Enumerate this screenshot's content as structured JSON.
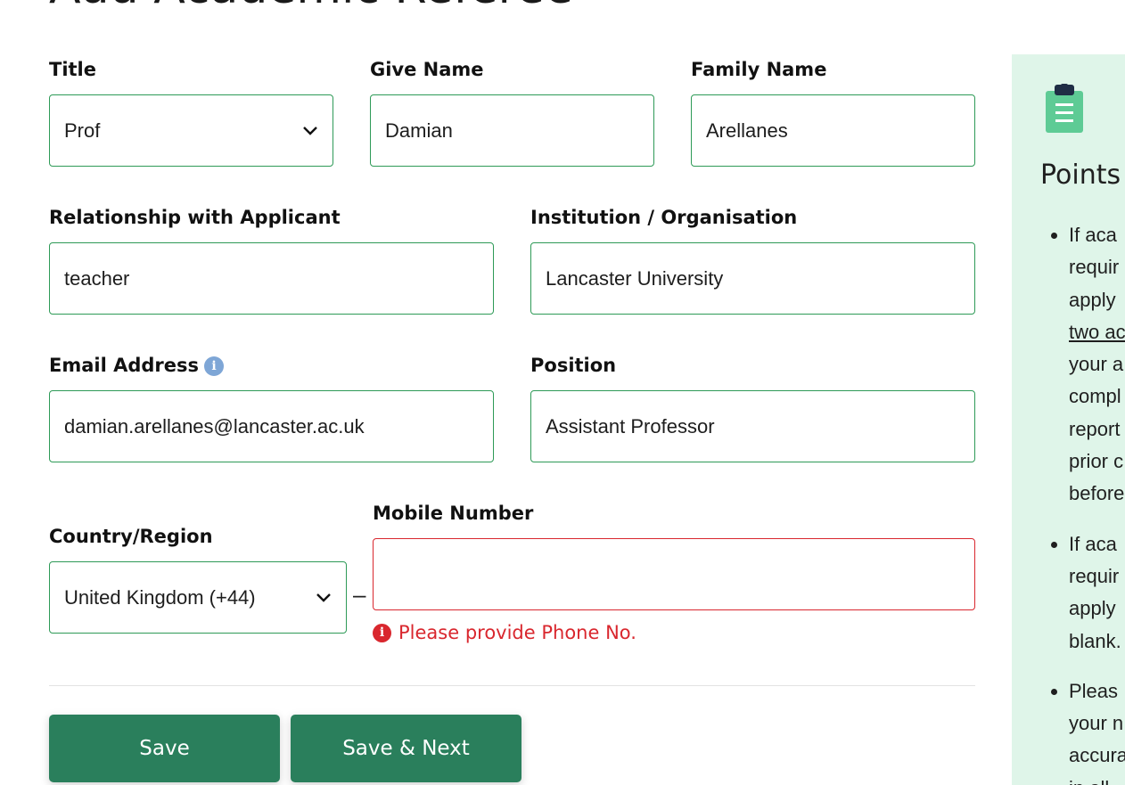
{
  "page": {
    "heading": "Add Academic Referee"
  },
  "form": {
    "title": {
      "label": "Title",
      "value": "Prof"
    },
    "given_name": {
      "label": "Give Name",
      "value": "Damian"
    },
    "family_name": {
      "label": "Family Name",
      "value": "Arellanes"
    },
    "relationship": {
      "label": "Relationship with Applicant",
      "value": "teacher"
    },
    "institution": {
      "label": "Institution / Organisation",
      "value": "Lancaster University"
    },
    "email": {
      "label": "Email Address",
      "value": "damian.arellanes@lancaster.ac.uk"
    },
    "position": {
      "label": "Position",
      "value": "Assistant Professor"
    },
    "country": {
      "label": "Country/Region",
      "value": "United Kingdom (+44)"
    },
    "separator": "–",
    "mobile": {
      "label": "Mobile Number",
      "value": "",
      "error": "Please provide Phone No."
    }
  },
  "buttons": {
    "save": "Save",
    "save_next": "Save & Next"
  },
  "side_panel": {
    "title": "Points",
    "items": [
      [
        "If aca",
        "requir",
        "apply",
        "two ac",
        "your a",
        "compl",
        "report",
        "prior c",
        "before"
      ],
      [
        "If aca",
        "requir",
        "apply",
        "blank."
      ],
      [
        "Pleas",
        "your n",
        "accura",
        "in all"
      ]
    ]
  },
  "colors": {
    "accent": "#2a7f5c",
    "field_border": "#2e9a57",
    "error": "#d9272e",
    "panel_bg": "#dff5e9",
    "icon_green": "#5ecb95"
  },
  "icons": [
    "chevron-down-icon",
    "info-icon",
    "error-icon",
    "clipboard-icon"
  ]
}
